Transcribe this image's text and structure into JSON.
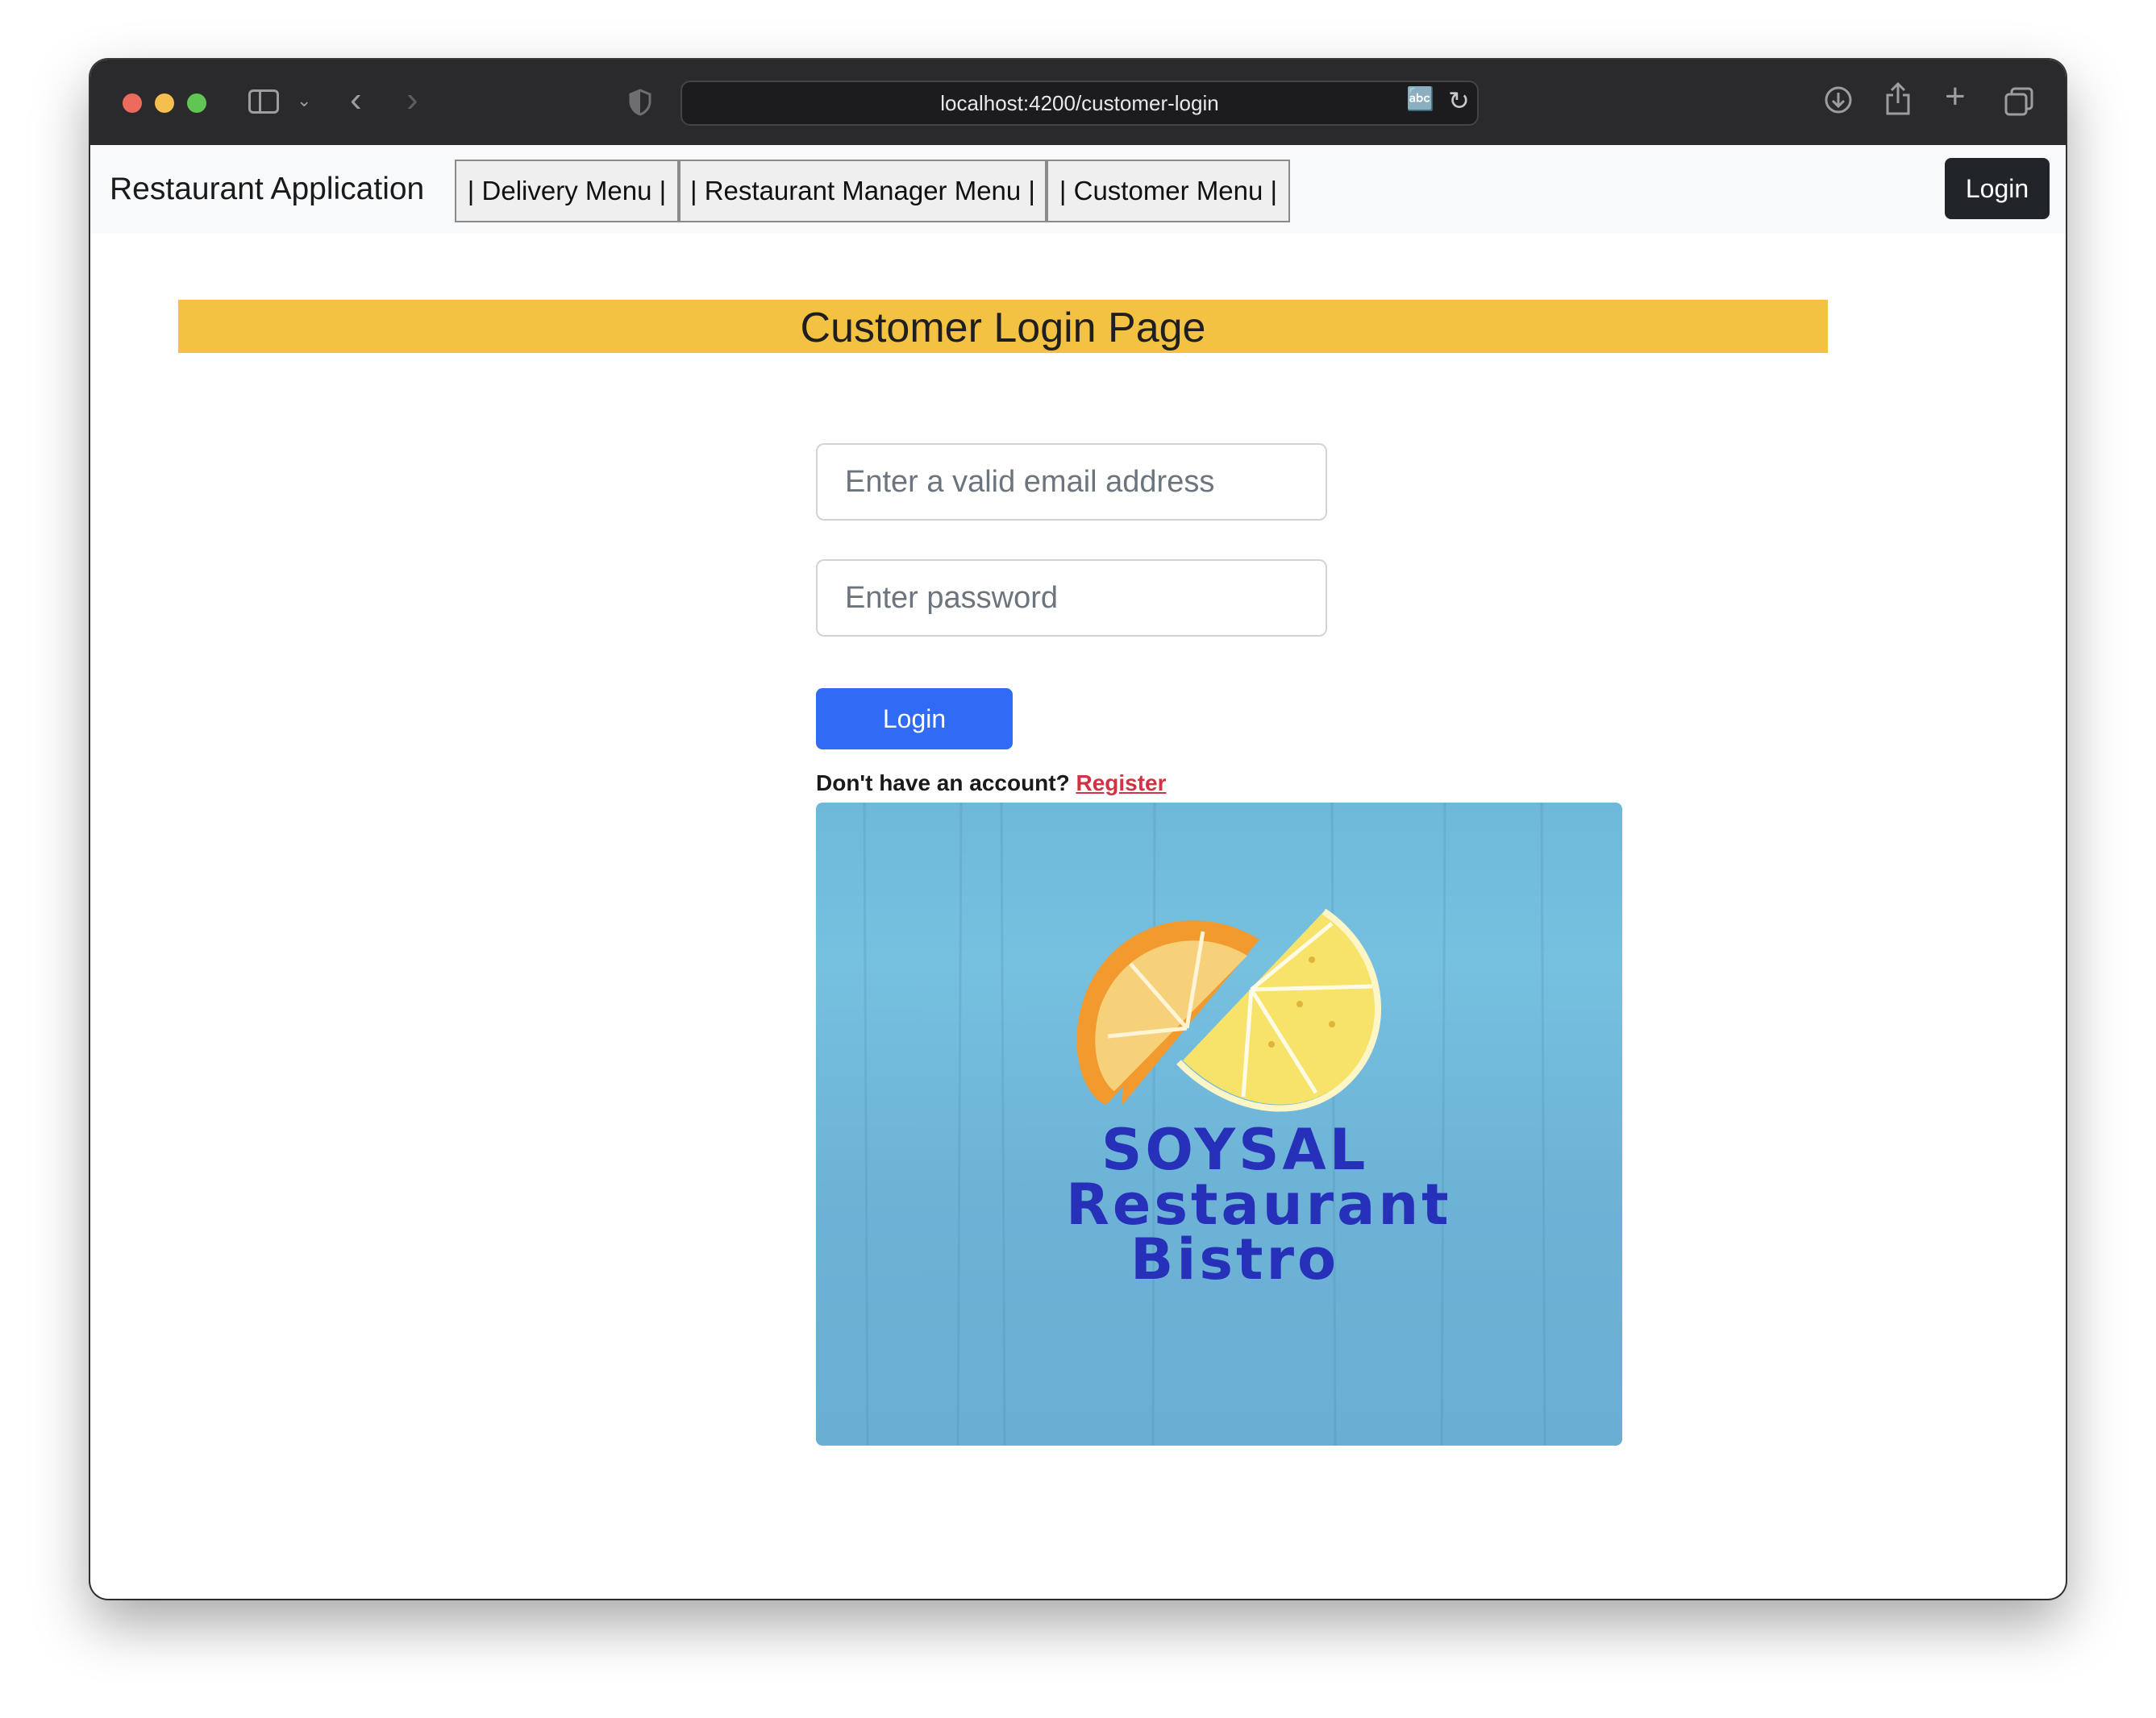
{
  "browser": {
    "url": "localhost:4200/customer-login"
  },
  "navbar": {
    "brand": "Restaurant Application",
    "links": [
      {
        "label": "| Delivery Menu |"
      },
      {
        "label": "| Restaurant Manager Menu |"
      },
      {
        "label": "| Customer Menu |"
      }
    ],
    "login_label": "Login"
  },
  "page": {
    "title": "Customer Login Page",
    "banner_color": "#f4c243"
  },
  "form": {
    "email_placeholder": "Enter a valid email address",
    "email_value": "",
    "password_placeholder": "Enter password",
    "password_value": "",
    "submit_label": "Login",
    "submit_color": "#2f6bf5",
    "register_prompt": "Don't have an account?",
    "register_link": "Register"
  },
  "logo": {
    "line1": "SOYSAL",
    "line2": "Restaurant",
    "line3": "Bistro"
  }
}
